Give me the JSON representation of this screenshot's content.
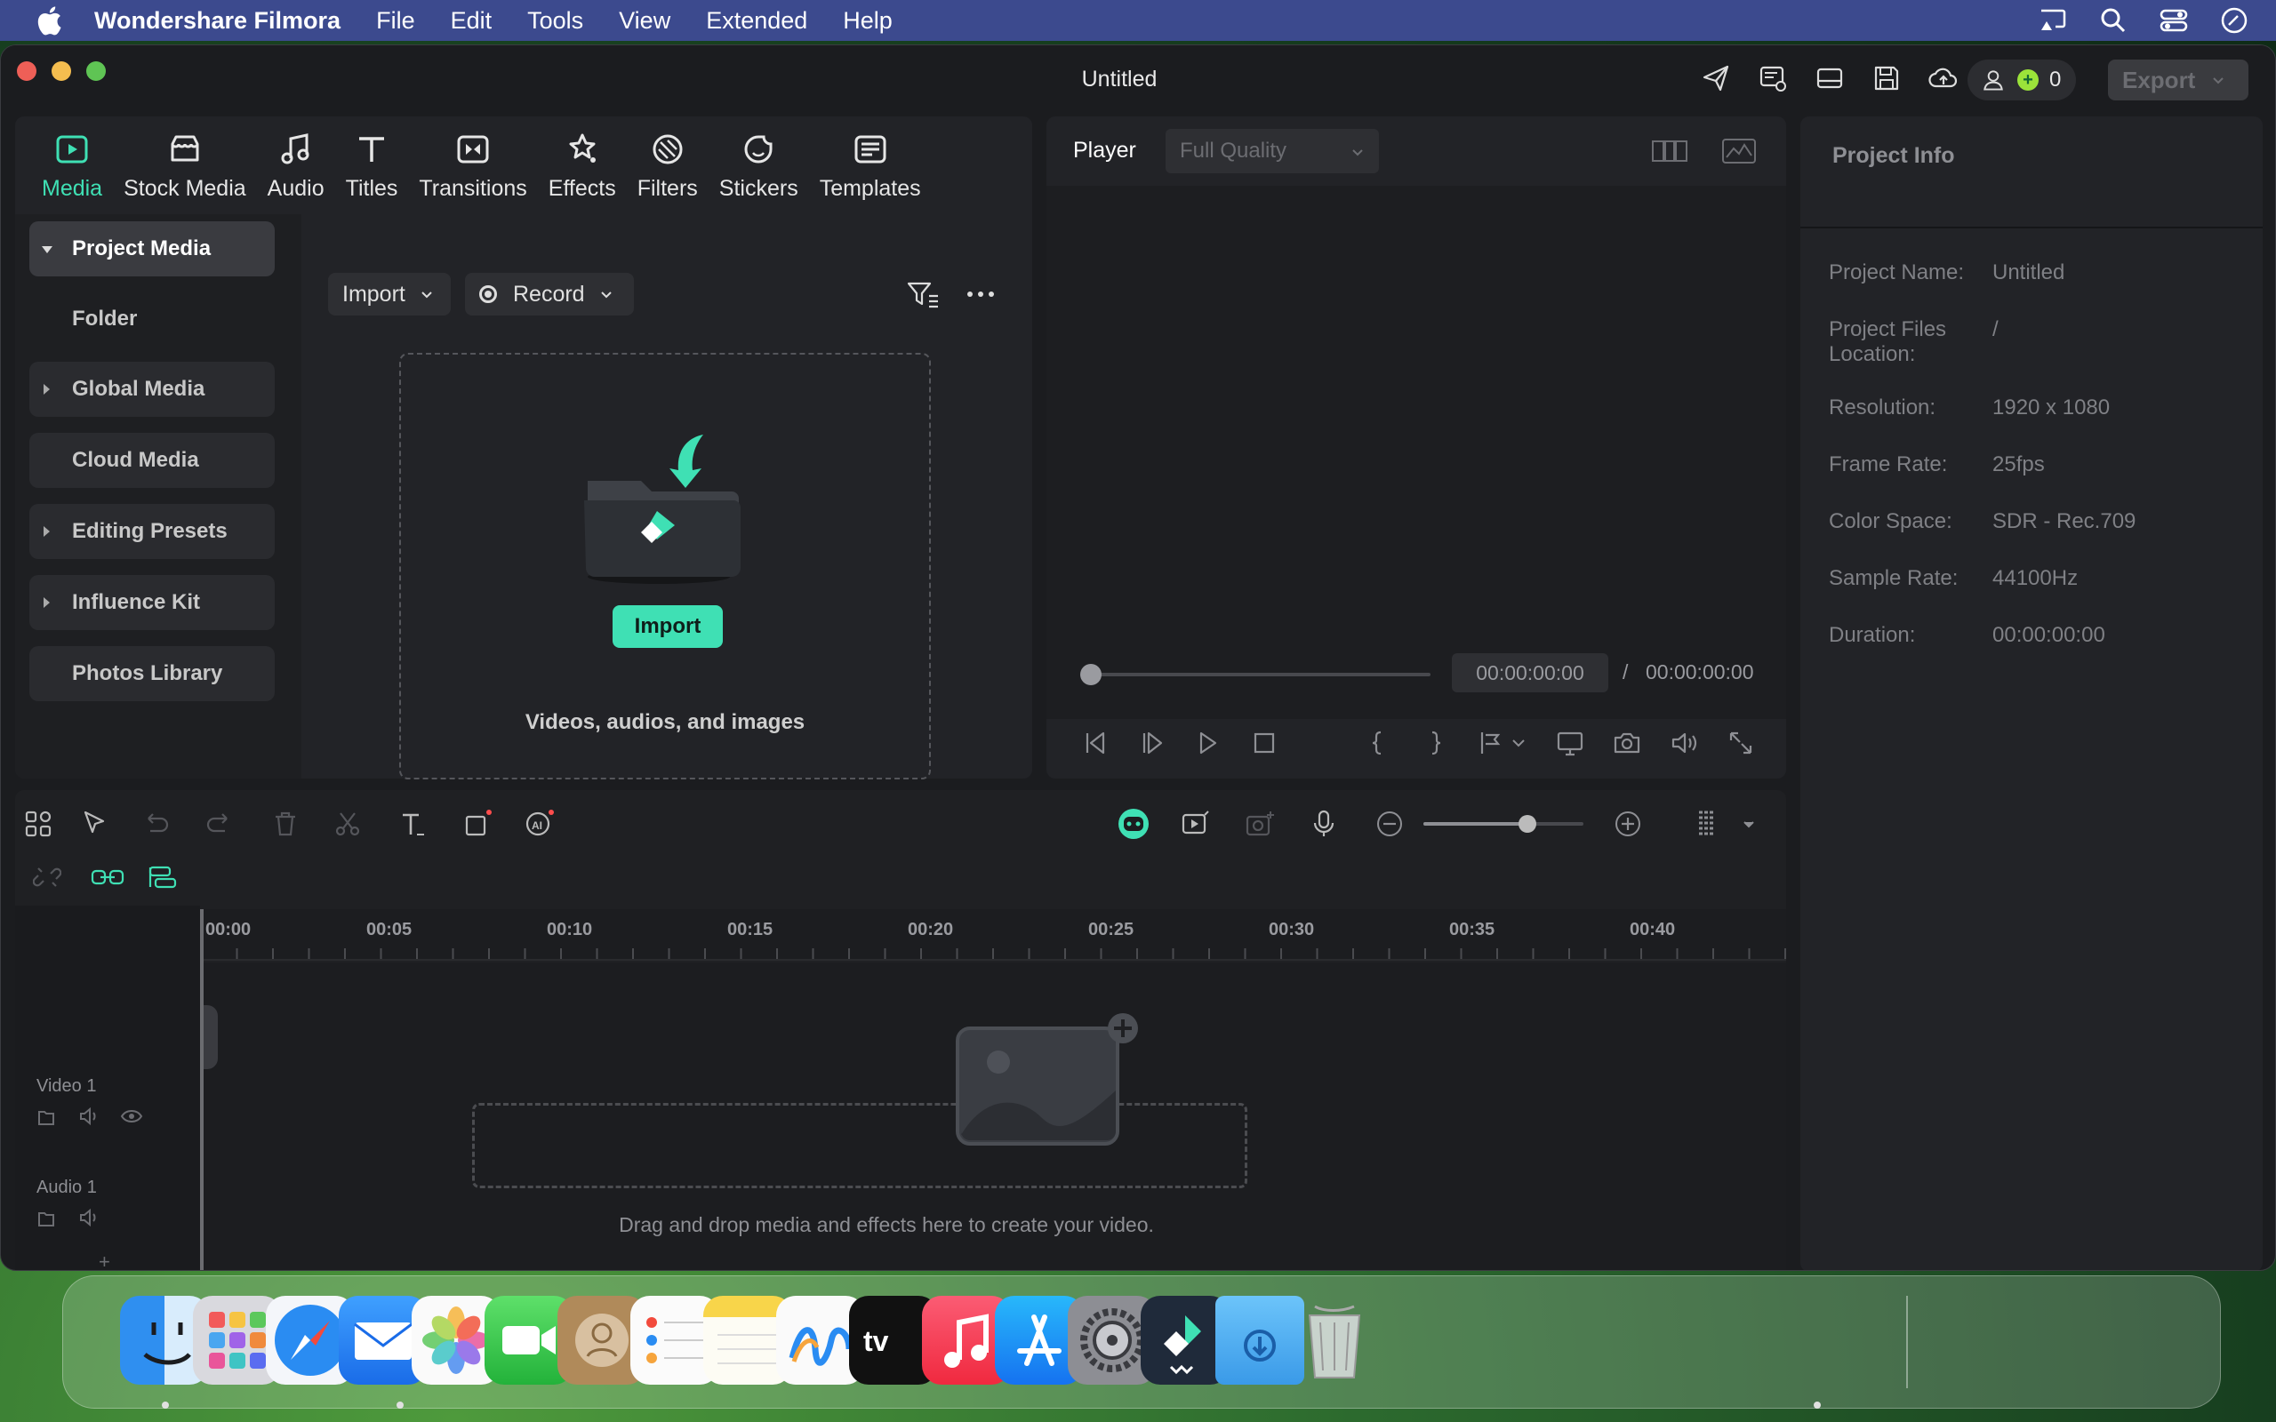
{
  "menubar": {
    "app_name": "Wondershare Filmora",
    "items": [
      "File",
      "Edit",
      "Tools",
      "View",
      "Extended",
      "Help"
    ],
    "status_icons": [
      "cast-icon",
      "search-icon",
      "control-center-icon",
      "siri-icon"
    ]
  },
  "window": {
    "title": "Untitled",
    "credits": "0",
    "export_label": "Export",
    "toolbar_icons": [
      "send-icon",
      "screen-record-icon",
      "layout-icon",
      "save-icon",
      "cloud-upload-icon",
      "headset-icon",
      "grid-apps-icon",
      "user-icon"
    ]
  },
  "media_tabs": [
    {
      "label": "Media",
      "icon": "media-icon",
      "active": true
    },
    {
      "label": "Stock Media",
      "icon": "stock-media-icon"
    },
    {
      "label": "Audio",
      "icon": "music-note-icon"
    },
    {
      "label": "Titles",
      "icon": "titles-icon"
    },
    {
      "label": "Transitions",
      "icon": "transitions-icon"
    },
    {
      "label": "Effects",
      "icon": "effects-icon"
    },
    {
      "label": "Filters",
      "icon": "filters-icon"
    },
    {
      "label": "Stickers",
      "icon": "stickers-icon"
    },
    {
      "label": "Templates",
      "icon": "templates-icon"
    }
  ],
  "sidebar": {
    "items": [
      {
        "label": "Project Media",
        "expanded": true
      },
      {
        "label": "Folder"
      },
      {
        "label": "Global Media"
      },
      {
        "label": "Cloud Media"
      },
      {
        "label": "Editing Presets"
      },
      {
        "label": "Influence Kit"
      },
      {
        "label": "Photos Library"
      }
    ]
  },
  "media": {
    "import_label": "Import",
    "record_label": "Record",
    "drop_button": "Import",
    "drop_text": "Videos, audios, and images"
  },
  "player": {
    "label": "Player",
    "quality": "Full Quality",
    "current_time": "00:00:00:00",
    "separator": "/",
    "total_time": "00:00:00:00"
  },
  "project_info": {
    "title": "Project Info",
    "rows": [
      {
        "key": "Project Name:",
        "value": "Untitled"
      },
      {
        "key": "Project Files Location:",
        "value": "/"
      },
      {
        "key": "Resolution:",
        "value": "1920 x 1080"
      },
      {
        "key": "Frame Rate:",
        "value": "25fps"
      },
      {
        "key": "Color Space:",
        "value": "SDR - Rec.709"
      },
      {
        "key": "Sample Rate:",
        "value": "44100Hz"
      },
      {
        "key": "Duration:",
        "value": "00:00:00:00"
      }
    ]
  },
  "timeline": {
    "ruler": [
      "00:00",
      "00:05",
      "00:10",
      "00:15",
      "00:20",
      "00:25",
      "00:30",
      "00:35",
      "00:40"
    ],
    "tracks": [
      {
        "name": "Video 1"
      },
      {
        "name": "Audio 1"
      }
    ],
    "hint": "Drag and drop media and effects here to create your video.",
    "zoom_level": 0.65
  },
  "dock": {
    "apps": [
      "Finder",
      "Launchpad",
      "Safari",
      "Mail",
      "Photos",
      "FaceTime",
      "Contacts",
      "Reminders",
      "Notes",
      "Freeform",
      "TV",
      "Music",
      "App Store",
      "System Settings",
      "Wondershare Filmora",
      "Downloads",
      "Trash"
    ]
  },
  "colors": {
    "accent": "#3fe0b4",
    "menubar": "#3c4a8e",
    "window_bg": "#1b1c1f"
  }
}
